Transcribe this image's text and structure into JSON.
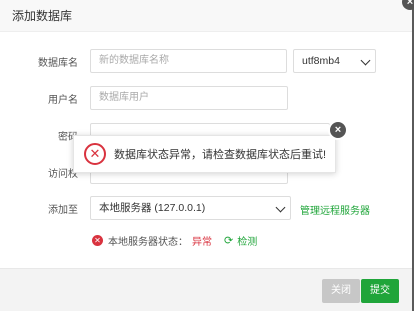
{
  "dialog": {
    "title": "添加数据库",
    "close_glyph": "×"
  },
  "form": {
    "db_name": {
      "label": "数据库名",
      "placeholder": "新的数据库名称",
      "charset": "utf8mb4"
    },
    "username": {
      "label": "用户名",
      "placeholder": "数据库用户"
    },
    "password": {
      "label": "密码"
    },
    "access": {
      "label": "访问权"
    },
    "add_to": {
      "label": "添加至",
      "server": "本地服务器 (127.0.0.1)",
      "manage_link": "管理远程服务器"
    },
    "status": {
      "label": "本地服务器状态：",
      "value": "异常",
      "check_label": "检测"
    }
  },
  "toast": {
    "message": "数据库状态异常，请检查数据库状态后重试!",
    "close_glyph": "×"
  },
  "footer": {
    "close_label": "关闭",
    "submit_label": "提交"
  },
  "colors": {
    "accent": "#20a53a",
    "error": "#d9333f"
  }
}
